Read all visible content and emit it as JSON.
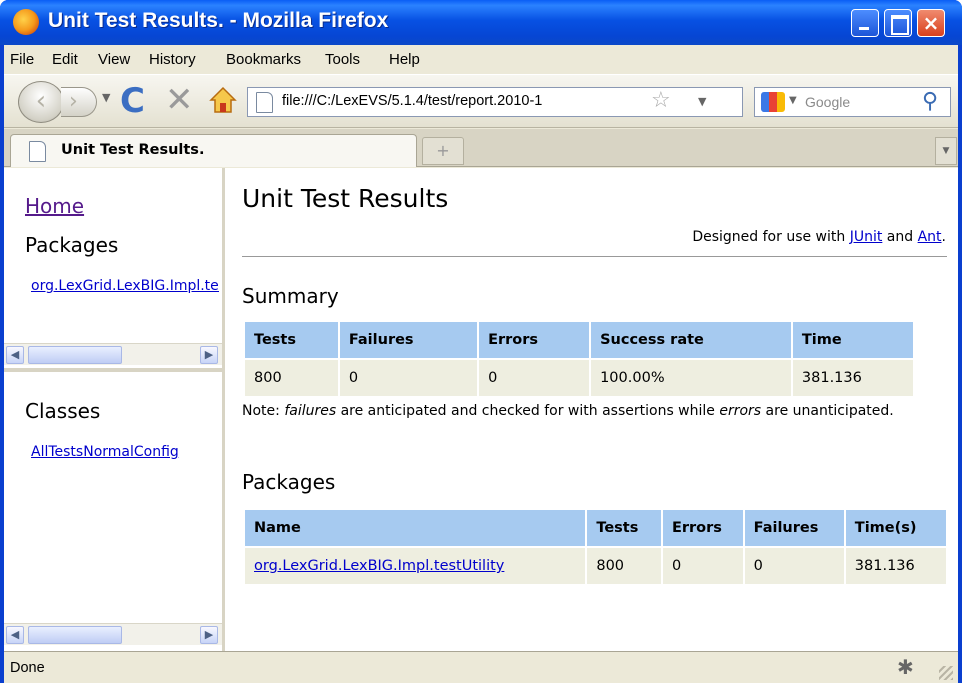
{
  "window": {
    "title": "Unit Test Results. - Mozilla Firefox",
    "close_glyph": "×"
  },
  "menu": [
    "File",
    "Edit",
    "View",
    "History",
    "Bookmarks",
    "Tools",
    "Help"
  ],
  "nav": {
    "back_glyph": "‹",
    "forward_glyph": "›",
    "reload_glyph": "C",
    "stop_glyph": "✕",
    "url": "file:///C:/LexEVS/5.1.4/test/report.2010-1",
    "star_glyph": "☆",
    "search_placeholder": "Google",
    "search_glyph": "⚲"
  },
  "tabs": {
    "active_label": "Unit Test Results.",
    "newtab_glyph": "+",
    "list_glyph": "▼"
  },
  "left_frame": {
    "home_link": "Home",
    "packages_heading": "Packages",
    "package_link": "org.LexGrid.LexBIG.Impl.testUtility",
    "classes_heading": "Classes",
    "class_link": "AllTestsNormalConfig"
  },
  "main": {
    "title": "Unit Test Results",
    "designed_prefix": "Designed for use with ",
    "junit_link": "JUnit",
    "designed_mid": " and ",
    "ant_link": "Ant",
    "designed_suffix": ".",
    "summary_heading": "Summary",
    "summary_table": {
      "headers": [
        "Tests",
        "Failures",
        "Errors",
        "Success rate",
        "Time"
      ],
      "row": [
        "800",
        "0",
        "0",
        "100.00%",
        "381.136"
      ]
    },
    "note_1": "Note: ",
    "note_failures": "failures",
    "note_2": " are anticipated and checked for with assertions while ",
    "note_errors": "errors",
    "note_3": " are unanticipated.",
    "packages_heading": "Packages",
    "packages_table": {
      "headers": [
        "Name",
        "Tests",
        "Errors",
        "Failures",
        "Time(s)"
      ],
      "row": [
        "org.LexGrid.LexBIG.Impl.testUtility",
        "800",
        "0",
        "0",
        "381.136"
      ]
    }
  },
  "status": {
    "text": "Done"
  }
}
